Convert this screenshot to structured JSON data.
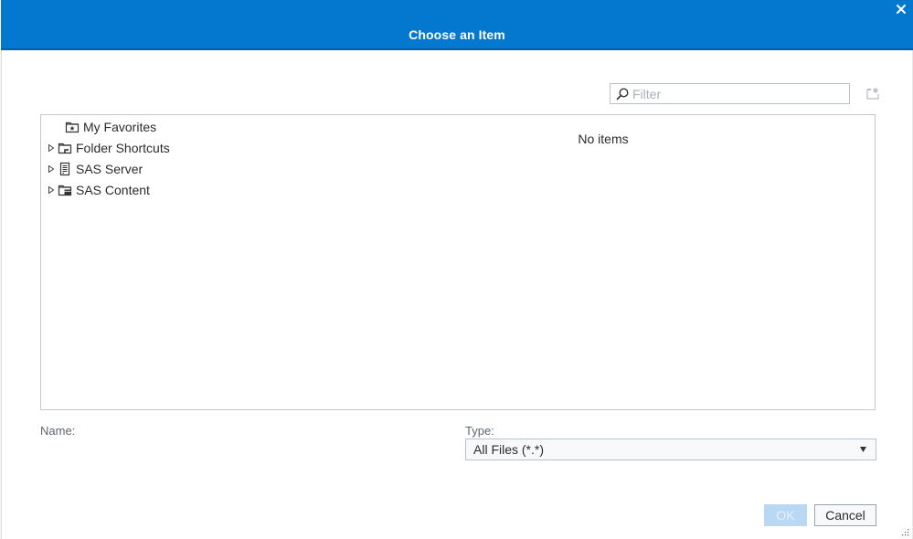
{
  "dialog": {
    "title": "Choose an Item",
    "close_label": "×"
  },
  "toolbar": {
    "filter_placeholder": "Filter",
    "filter_value": "",
    "search_icon": "search-icon",
    "new_folder_icon": "new-folder-icon"
  },
  "tree": {
    "items": [
      {
        "label": "My Favorites",
        "icon": "favorites-folder-icon",
        "expandable": false
      },
      {
        "label": "Folder Shortcuts",
        "icon": "folder-shortcut-icon",
        "expandable": true
      },
      {
        "label": "SAS Server",
        "icon": "server-icon",
        "expandable": true
      },
      {
        "label": "SAS Content",
        "icon": "content-folder-icon",
        "expandable": true
      }
    ]
  },
  "list": {
    "empty_message": "No items"
  },
  "form": {
    "name_label": "Name:",
    "type_label": "Type:",
    "type_selected": "All Files (*.*)"
  },
  "buttons": {
    "ok_label": "OK",
    "ok_enabled": false,
    "cancel_label": "Cancel"
  },
  "colors": {
    "header_bg": "#0478cf",
    "ok_disabled_bg": "#b9d8f3",
    "border": "#c2c9d1"
  }
}
